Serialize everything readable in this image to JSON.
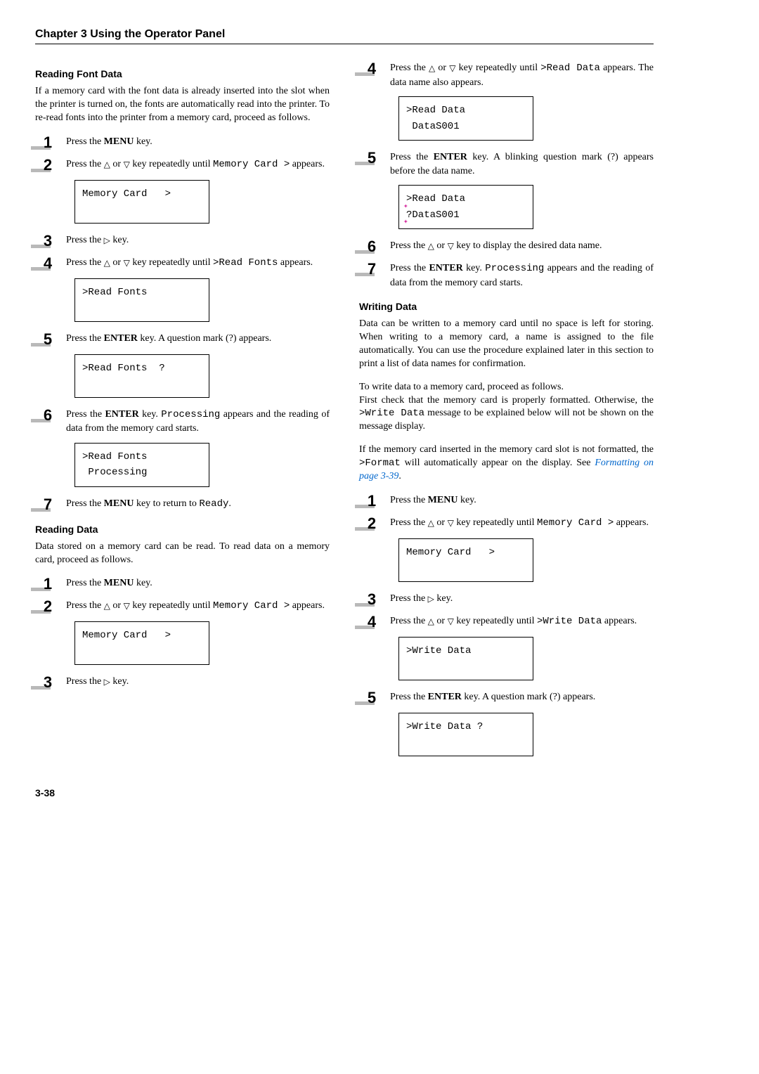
{
  "chapter_header": "Chapter 3  Using the Operator Panel",
  "page_number": "3-38",
  "left": {
    "sec1_title": "Reading Font Data",
    "sec1_intro": "If a memory card with the font data is already inserted into the slot when the printer is turned on, the fonts are automatically read into the printer. To re-read fonts into the printer from a memory card, proceed as follows.",
    "s1": {
      "pre": "Press the ",
      "bold": "MENU",
      "post": " key."
    },
    "s2": {
      "pre": "Press the ",
      "sym1": "△",
      "mid": " or ",
      "sym2": "▽",
      "post1": " key repeatedly until ",
      "mono": "Memory Card >",
      "post2": " appears."
    },
    "lcd2": "Memory Card   >",
    "s3": {
      "pre": "Press the ",
      "sym": "▷",
      "post": " key."
    },
    "s4": {
      "pre": "Press the ",
      "sym1": "△",
      "mid": " or ",
      "sym2": "▽",
      "post1": " key repeatedly until ",
      "mono": ">Read Fonts",
      "post2": " appears."
    },
    "lcd4": ">Read Fonts",
    "s5": {
      "pre": "Press the ",
      "bold": "ENTER",
      "post": " key. A question mark (?) appears."
    },
    "lcd5": ">Read Fonts  ?",
    "s6": {
      "pre": "Press the ",
      "bold": "ENTER",
      "post1": " key. ",
      "mono": "Processing",
      "post2": " appears and the reading of data from the memory card starts."
    },
    "lcd6": ">Read Fonts\n Processing",
    "s7": {
      "pre": "Press the ",
      "bold": "MENU",
      "post1": " key to return to ",
      "mono": "Ready",
      "post2": "."
    },
    "sec2_title": "Reading Data",
    "sec2_intro": "Data stored on a memory card can be read. To read data on a memory card, proceed as follows.",
    "d1": {
      "pre": "Press the ",
      "bold": "MENU",
      "post": " key."
    },
    "d2": {
      "pre": "Press the ",
      "sym1": "△",
      "mid": " or ",
      "sym2": "▽",
      "post1": " key repeatedly until ",
      "mono": "Memory Card >",
      "post2": " appears."
    },
    "lcd_d2": "Memory Card   >",
    "d3": {
      "pre": "Press the ",
      "sym": "▷",
      "post": " key."
    }
  },
  "right": {
    "s4": {
      "pre": "Press the ",
      "sym1": "△",
      "mid": " or ",
      "sym2": "▽",
      "post1": " key repeatedly until ",
      "mono": ">Read Data",
      "post2": " appears. The data name also appears."
    },
    "lcd4": ">Read Data\n DataS001",
    "s5": {
      "pre": "Press the ",
      "bold": "ENTER",
      "post": " key. A blinking question mark (?) appears before the data name."
    },
    "lcd5_line1": ">Read Data",
    "lcd5_q": "?",
    "lcd5_rest": "DataS001",
    "s6": {
      "pre": "Press the ",
      "sym1": "△",
      "mid": " or ",
      "sym2": "▽",
      "post": " key to display the desired data name."
    },
    "s7": {
      "pre": "Press the ",
      "bold": "ENTER",
      "post1": " key. ",
      "mono": "Processing",
      "post2": " appears and the reading of data from the memory card starts."
    },
    "sec_title": "Writing Data",
    "sec_intro": "Data can be written to a memory card until no space is left for storing. When writing to a memory card, a name is assigned to the file automatically. You can use the procedure explained later in this section to print a list of data names for confirmation.",
    "p2a": "To write data to a memory card, proceed as follows.",
    "p2b_pre": "First check that the memory card is properly formatted. Otherwise, the ",
    "p2b_mono": ">Write Data",
    "p2b_post": " message to be explained below will not be shown on the message display.",
    "p3_pre": "If the memory card inserted in the memory card slot is not formatted, the ",
    "p3_mono": ">Format",
    "p3_mid": " will automatically appear on the display. See ",
    "p3_link": "Formatting on page 3-39",
    "p3_post": ".",
    "w1": {
      "pre": "Press the ",
      "bold": "MENU",
      "post": " key."
    },
    "w2": {
      "pre": "Press the ",
      "sym1": "△",
      "mid": " or ",
      "sym2": "▽",
      "post1": " key repeatedly until ",
      "mono": "Memory Card >",
      "post2": " appears."
    },
    "lcd_w2": "Memory Card   >",
    "w3": {
      "pre": "Press the ",
      "sym": "▷",
      "post": " key."
    },
    "w4": {
      "pre": "Press the ",
      "sym1": "△",
      "mid": " or ",
      "sym2": "▽",
      "post1": " key repeatedly until ",
      "mono": ">Write Data",
      "post2": " appears."
    },
    "lcd_w4": ">Write Data",
    "w5": {
      "pre": "Press the ",
      "bold": "ENTER",
      "post": " key. A question mark (?) appears."
    },
    "lcd_w5": ">Write Data ?"
  }
}
